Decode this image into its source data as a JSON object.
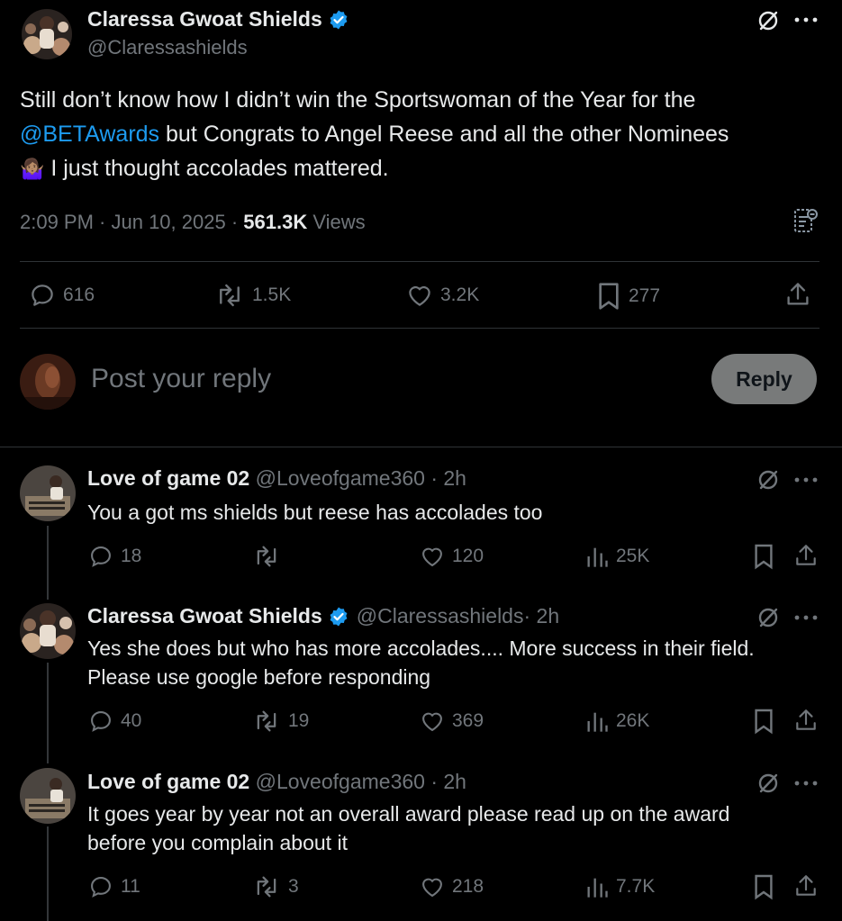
{
  "main_post": {
    "author_name": "Claressa Gwoat Shields",
    "handle": "@Claressashields",
    "text_line1": "Still don’t know how I didn’t win the Sportswoman of the Year for the",
    "mention": "@BETAwards",
    "text_line2_rest": " but Congrats to Angel Reese and all the other Nominees",
    "emoji": "🤷🏽‍♀️",
    "text_line3_rest": " I just thought accolades mattered.",
    "timestamp": "2:09 PM · Jun 10, 2025 · ",
    "views_count": "561.3K",
    "views_label": " Views",
    "stats": {
      "replies": "616",
      "reposts": "1.5K",
      "likes": "3.2K",
      "bookmarks": "277"
    }
  },
  "composer": {
    "placeholder": "Post your reply",
    "reply_label": "Reply"
  },
  "replies": [
    {
      "name": "Love of game 02",
      "handle": "@Loveofgame360",
      "time": " · 2h",
      "text_lines": [
        "You a got ms shields but reese has accolades too"
      ],
      "stats": {
        "replies": "18",
        "reposts": "",
        "likes": "120",
        "views": "25K"
      }
    },
    {
      "name": "Claressa Gwoat Shields",
      "handle": "@Claressashields",
      "time": " · 2h",
      "text_lines": [
        "Yes she does but who has more accolades.... More success in their field.",
        "Please use google before responding"
      ],
      "stats": {
        "replies": "40",
        "reposts": "19",
        "likes": "369",
        "views": "26K"
      }
    },
    {
      "name": "Love of game 02",
      "handle": "@Loveofgame360",
      "time": " · 2h",
      "text_lines": [
        "It goes year by year not an overall award please read up on the award",
        "before you complain about it"
      ],
      "stats": {
        "replies": "11",
        "reposts": "3",
        "likes": "218",
        "views": "7.7K"
      }
    }
  ],
  "colors": {
    "background": "#000000",
    "text": "#e7e9ea",
    "muted": "#71767b",
    "link": "#1d9bf0",
    "verified": "#1d9bf0",
    "divider": "#2f3336"
  }
}
